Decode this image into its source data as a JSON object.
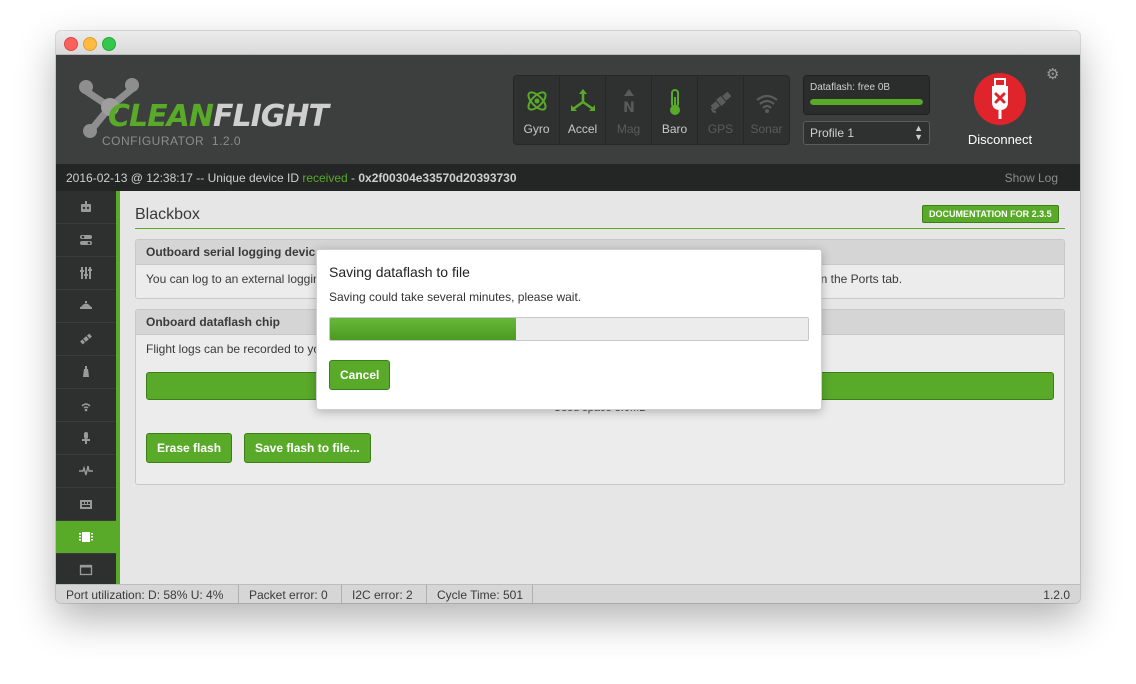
{
  "app": {
    "logo_clean": "CLEAN",
    "logo_flight": "FLIGHT",
    "subtitle": "CONFIGURATOR",
    "version": "1.2.0",
    "accent_color": "#59aa29"
  },
  "sensors": [
    {
      "label": "Gyro",
      "icon": "gyro-icon",
      "active": true
    },
    {
      "label": "Accel",
      "icon": "accel-icon",
      "active": true
    },
    {
      "label": "Mag",
      "icon": "mag-icon",
      "active": false
    },
    {
      "label": "Baro",
      "icon": "baro-icon",
      "active": true
    },
    {
      "label": "GPS",
      "icon": "gps-icon",
      "active": false
    },
    {
      "label": "Sonar",
      "icon": "sonar-icon",
      "active": false
    }
  ],
  "dataflash": {
    "label": "Dataflash: free 0B",
    "used_fraction": 1.0
  },
  "profile": {
    "selected": "Profile 1"
  },
  "connect": {
    "label": "Disconnect",
    "icon": "usb-disconnect-icon"
  },
  "log": {
    "prefix": "2016-02-13 @ 12:38:17 -- Unique device ID ",
    "received": "received",
    "sep": " - ",
    "device_id": "0x2f00304e33570d20393730",
    "show_log": "Show Log"
  },
  "sidebar": {
    "items": [
      {
        "icon": "setup-icon"
      },
      {
        "icon": "ports-icon"
      },
      {
        "icon": "configuration-icon"
      },
      {
        "icon": "pid-tuning-icon"
      },
      {
        "icon": "gps-icon"
      },
      {
        "icon": "motors-icon"
      },
      {
        "icon": "led-strip-icon"
      },
      {
        "icon": "sensors-icon"
      },
      {
        "icon": "logging-icon"
      },
      {
        "icon": "cli-icon"
      },
      {
        "icon": "dataflash-icon",
        "active": true
      },
      {
        "icon": "window-icon"
      }
    ]
  },
  "blackbox": {
    "title": "Blackbox",
    "doc_button": "DOCUMENTATION FOR 2.3.5",
    "outboard": {
      "title": "Outboard serial logging device",
      "text": "You can log to an external logging device (such as an OpenLog or compatible clone) by using a serial port. Configure the port on the Ports tab."
    },
    "onboard": {
      "title": "Onboard dataflash chip",
      "text": "Flight logs can be recorded to your flight controller's onboard dataflash chip.",
      "used_space": "Used space 8.0MB",
      "erase_button": "Erase flash",
      "save_button": "Save flash to file..."
    }
  },
  "modal": {
    "title": "Saving dataflash to file",
    "text": "Saving could take several minutes, please wait.",
    "progress_fraction": 0.39,
    "cancel_label": "Cancel"
  },
  "status": {
    "port_util": "Port utilization: D: 58% U: 4%",
    "packet_error": "Packet error: 0",
    "i2c_error": "I2C error: 2",
    "cycle_time": "Cycle Time: 501",
    "version": "1.2.0"
  }
}
